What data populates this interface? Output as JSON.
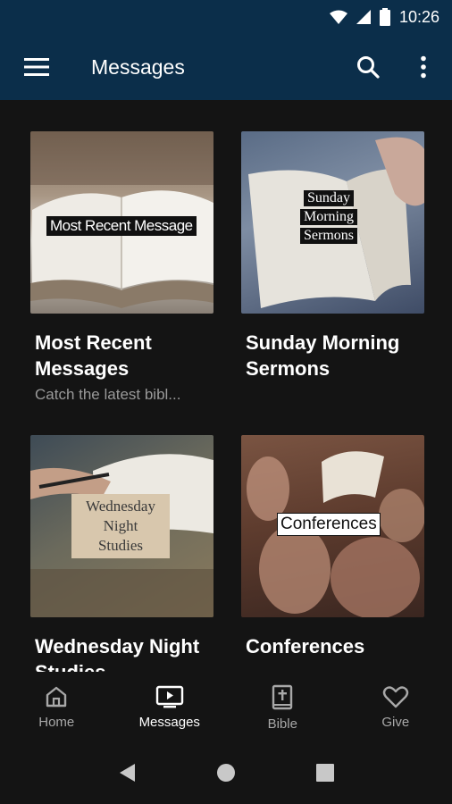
{
  "status_bar": {
    "time": "10:26"
  },
  "app_bar": {
    "title": "Messages"
  },
  "cards": [
    {
      "title": "Most Recent Messages",
      "subtitle": "Catch the latest bibl...",
      "image_label": "Most Recent Message"
    },
    {
      "title": "Sunday Morning Sermons",
      "subtitle": "",
      "image_label_lines": [
        "Sunday",
        "Morning",
        "Sermons"
      ]
    },
    {
      "title": "Wednesday Night Studies",
      "subtitle": "",
      "image_label_lines": [
        "Wednesday",
        "Night",
        "Studies"
      ]
    },
    {
      "title": "Conferences",
      "subtitle": "",
      "image_label": "Conferences"
    }
  ],
  "bottom_nav": [
    {
      "label": "Home",
      "icon": "home-icon",
      "active": false
    },
    {
      "label": "Messages",
      "icon": "tv-icon",
      "active": true
    },
    {
      "label": "Bible",
      "icon": "bible-icon",
      "active": false
    },
    {
      "label": "Give",
      "icon": "heart-icon",
      "active": false
    }
  ],
  "colors": {
    "app_bar": "#0b2e4a",
    "background": "#141414",
    "inactive_nav": "#a8a8a8"
  }
}
